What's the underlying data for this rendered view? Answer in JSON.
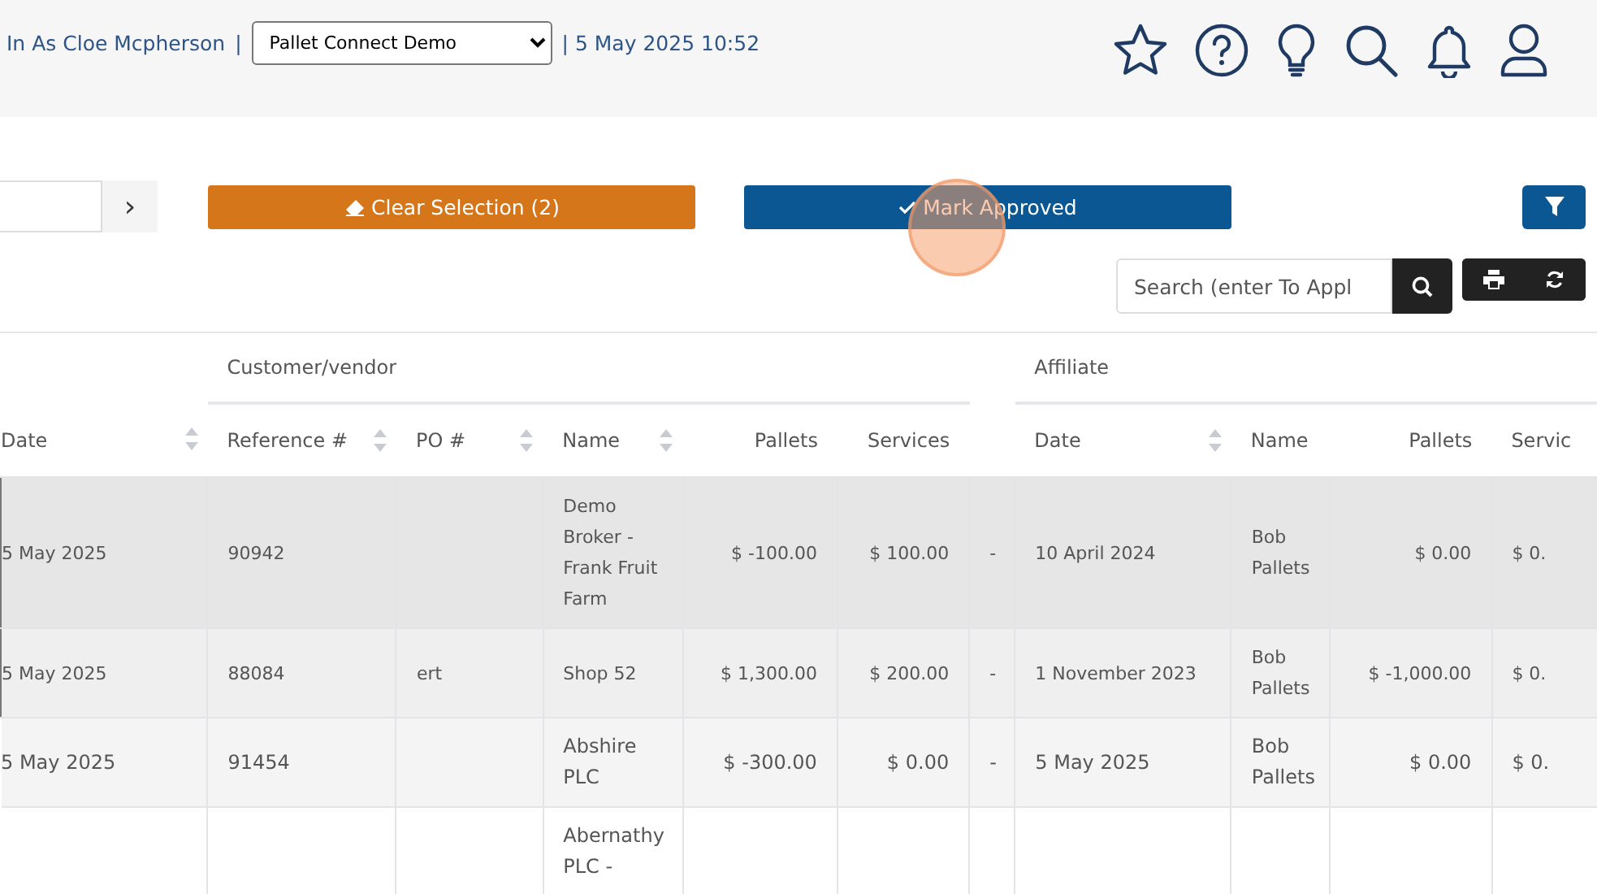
{
  "header": {
    "logged_in": "In As Cloe Mcpherson",
    "separator": "|",
    "company_select": "Pallet Connect Demo",
    "datetime": "| 5 May 2025 10:52"
  },
  "toolbar": {
    "next_label": "›",
    "clear_selection": "Clear Selection (2)",
    "mark_approved": "Mark Approved",
    "search_placeholder": "Search (enter To Appl"
  },
  "table": {
    "groups": [
      {
        "label": "Customer/vendor"
      },
      {
        "label": "Affiliate"
      }
    ],
    "columns": [
      {
        "label": "Date",
        "sortable": true
      },
      {
        "label": "Reference #",
        "sortable": true
      },
      {
        "label": "PO #",
        "sortable": true
      },
      {
        "label": "Name",
        "sortable": true
      },
      {
        "label": "Pallets",
        "sortable": false
      },
      {
        "label": "Services",
        "sortable": false
      },
      {
        "sortable": false
      },
      {
        "label": "Date",
        "sortable": true
      },
      {
        "label": "Name",
        "sortable": false
      },
      {
        "label": "Pallets",
        "sortable": false
      },
      {
        "label": "Servic"
      }
    ],
    "rows": [
      {
        "selected": true,
        "cells": [
          "5 May 2025",
          "90942",
          "",
          "Demo Broker - Frank Fruit Farm",
          "$ -100.00",
          "$ 100.00",
          "-",
          "10 April 2024",
          "Bob Pallets",
          "$ 0.00",
          "$ 0."
        ]
      },
      {
        "selected": true,
        "cells": [
          "5 May 2025",
          "88084",
          "ert",
          "Shop 52",
          "$ 1,300.00",
          "$ 200.00",
          "-",
          "1 November 2023",
          "Bob Pallets",
          "$ -1,000.00",
          "$ 0."
        ]
      },
      {
        "selected": false,
        "cells": [
          "5 May 2025",
          "91454",
          "",
          "Abshire PLC",
          "$ -300.00",
          "$ 0.00",
          "-",
          "5 May 2025",
          "Bob Pallets",
          "$ 0.00",
          "$ 0."
        ]
      },
      {
        "selected": false,
        "cells": [
          "",
          "",
          "",
          "Abernathy PLC -",
          "",
          "",
          "",
          "",
          "",
          "",
          ""
        ]
      }
    ]
  }
}
